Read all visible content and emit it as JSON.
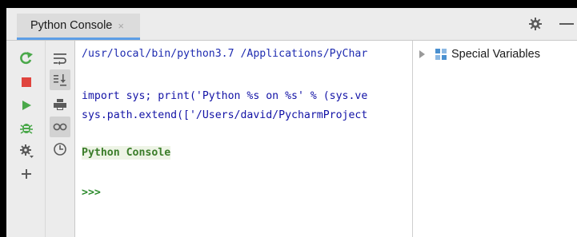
{
  "tab": {
    "title": "Python Console",
    "close": "×"
  },
  "console": {
    "command": "/usr/local/bin/python3.7 /Applications/PyChar",
    "line1": "import sys; print('Python %s on %s' % (sys.ve",
    "line2": "sys.path.extend(['/Users/david/PycharmProject",
    "banner": "Python Console",
    "prompt": ">>>"
  },
  "variables": {
    "title": "Special Variables"
  },
  "colors": {
    "accent": "#5d9ee6",
    "command_text": "#1e2bb0",
    "code_text": "#1212a6",
    "banner_text": "#3b7d2a",
    "prompt_text": "#2b8a2b",
    "run_green": "#4aa84a",
    "stop_red": "#e0443e",
    "debug_green": "#4aa84a"
  },
  "icons": {
    "rerun": "rerun-icon",
    "stop": "stop-icon",
    "run": "run-icon",
    "debug": "debug-icon",
    "settings": "gear-icon",
    "add": "plus-icon",
    "soft_wrap": "soft-wrap-icon",
    "scroll_end": "scroll-to-end-icon",
    "print": "print-icon",
    "show_vars": "show-variables-icon",
    "history": "history-icon"
  }
}
